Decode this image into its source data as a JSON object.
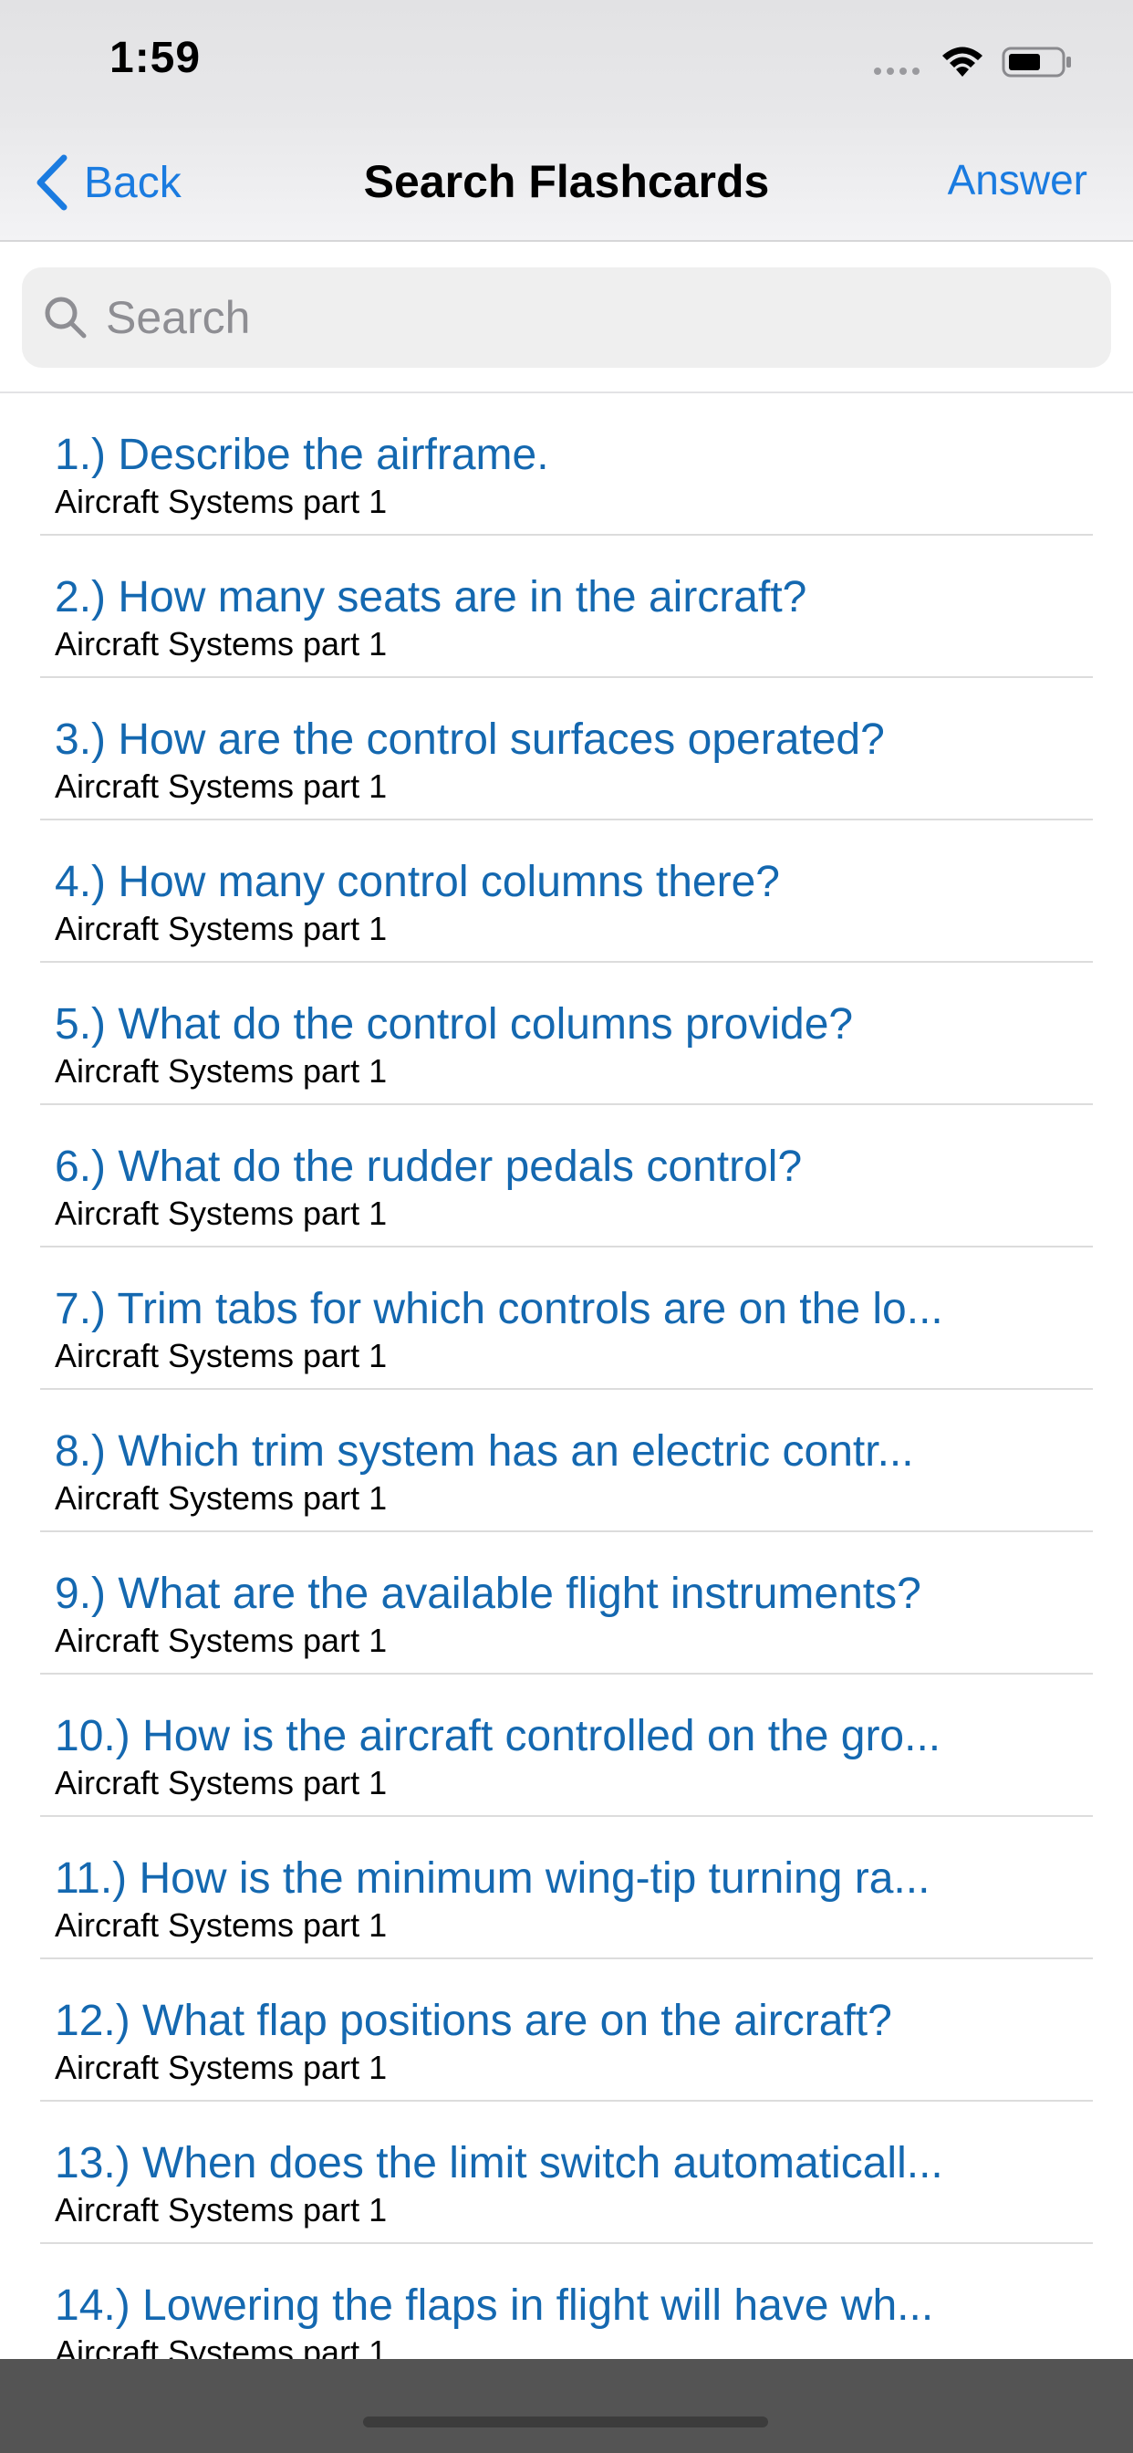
{
  "status_bar": {
    "time": "1:59",
    "icons": [
      "signal-dots-icon",
      "wifi-icon",
      "battery-icon"
    ]
  },
  "nav": {
    "back_label": "Back",
    "title": "Search Flashcards",
    "answer_label": "Answer"
  },
  "search": {
    "placeholder": "Search",
    "value": ""
  },
  "colors": {
    "accent": "#1a7be0",
    "item_title": "#1468b0"
  },
  "items": [
    {
      "title": "1.) Describe the airframe.",
      "subtitle": "Aircraft Systems part 1"
    },
    {
      "title": "2.) How many seats are in the aircraft?",
      "subtitle": "Aircraft Systems part 1"
    },
    {
      "title": "3.) How are the control surfaces operated?",
      "subtitle": "Aircraft Systems part 1"
    },
    {
      "title": "4.) How many control columns there?",
      "subtitle": "Aircraft Systems part 1"
    },
    {
      "title": "5.) What do the control columns provide?",
      "subtitle": "Aircraft Systems part 1"
    },
    {
      "title": "6.) What do the rudder pedals control?",
      "subtitle": "Aircraft Systems part 1"
    },
    {
      "title": "7.) Trim tabs for which controls are on the lo...",
      "subtitle": "Aircraft Systems part 1"
    },
    {
      "title": "8.) Which trim system has an electric contr...",
      "subtitle": "Aircraft Systems part 1"
    },
    {
      "title": "9.) What are the available flight instruments?",
      "subtitle": "Aircraft Systems part 1"
    },
    {
      "title": "10.) How is the aircraft controlled on the gro...",
      "subtitle": "Aircraft Systems part 1"
    },
    {
      "title": "11.) How is the minimum wing-tip turning ra...",
      "subtitle": "Aircraft Systems part 1"
    },
    {
      "title": "12.) What flap positions are on the aircraft?",
      "subtitle": "Aircraft Systems part 1"
    },
    {
      "title": "13.) When does the limit switch automaticall...",
      "subtitle": "Aircraft Systems part 1"
    },
    {
      "title": "14.) Lowering the flaps in flight will have wh...",
      "subtitle": "Aircraft Systems part 1"
    }
  ]
}
